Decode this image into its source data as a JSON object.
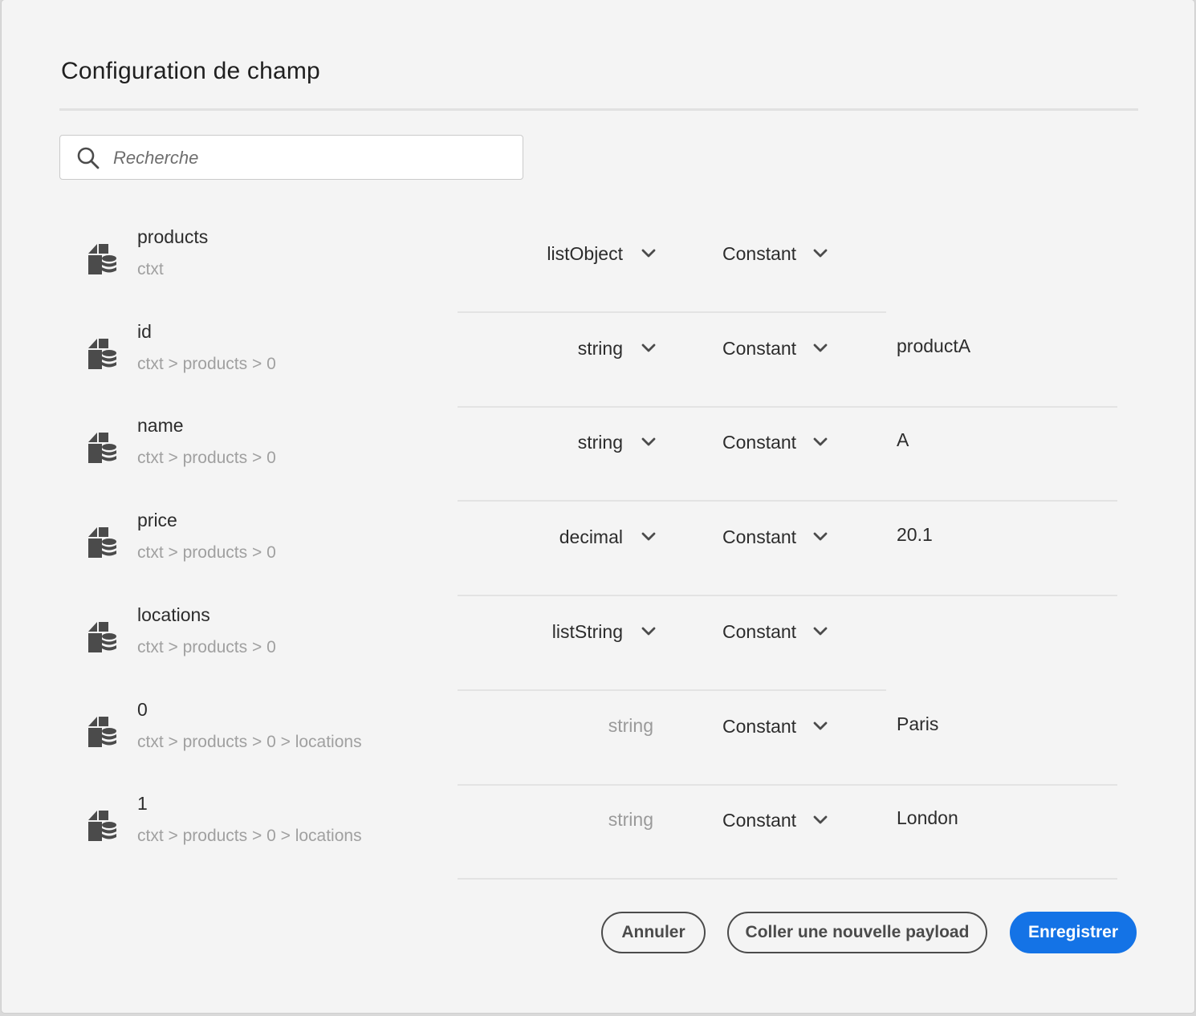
{
  "dialog": {
    "title": "Configuration de champ",
    "search_placeholder": "Recherche"
  },
  "rows": [
    {
      "name": "products",
      "path": "ctxt",
      "type": "listObject",
      "type_editable": true,
      "mode": "Constant",
      "value": ""
    },
    {
      "name": "id",
      "path": "ctxt > products > 0",
      "type": "string",
      "type_editable": true,
      "mode": "Constant",
      "value": "productA"
    },
    {
      "name": "name",
      "path": "ctxt > products > 0",
      "type": "string",
      "type_editable": true,
      "mode": "Constant",
      "value": "A"
    },
    {
      "name": "price",
      "path": "ctxt > products > 0",
      "type": "decimal",
      "type_editable": true,
      "mode": "Constant",
      "value": "20.1"
    },
    {
      "name": "locations",
      "path": "ctxt > products > 0",
      "type": "listString",
      "type_editable": true,
      "mode": "Constant",
      "value": ""
    },
    {
      "name": "0",
      "path": "ctxt > products > 0 > locations",
      "type": "string",
      "type_editable": false,
      "mode": "Constant",
      "value": "Paris"
    },
    {
      "name": "1",
      "path": "ctxt > products > 0 > locations",
      "type": "string",
      "type_editable": false,
      "mode": "Constant",
      "value": "London"
    }
  ],
  "buttons": {
    "cancel": "Annuler",
    "paste": "Coller une nouvelle payload",
    "save": "Enregistrer"
  },
  "icons": {
    "field": "field-schema-icon",
    "search": "search-icon",
    "chevron": "chevron-down-icon"
  },
  "colors": {
    "primary": "#1473e6",
    "background": "#f4f4f4"
  }
}
